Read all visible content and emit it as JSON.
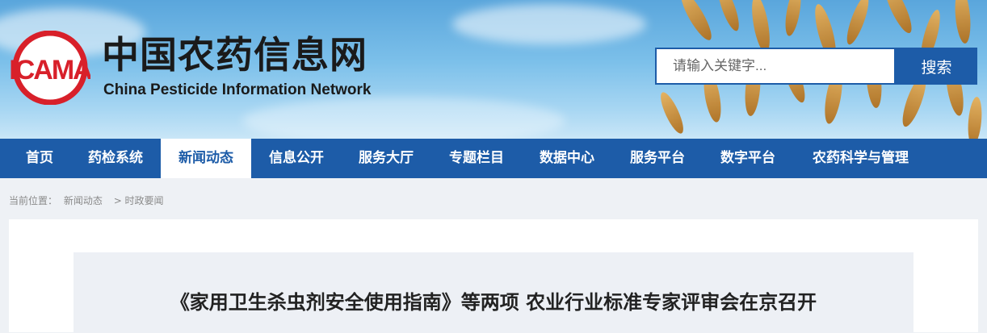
{
  "site": {
    "logo_text": "ICAMA",
    "title": "中国农药信息网",
    "subtitle": "China Pesticide Information Network"
  },
  "search": {
    "placeholder": "请输入关键字...",
    "button_label": "搜索"
  },
  "nav": {
    "items": [
      {
        "label": "首页"
      },
      {
        "label": "药检系统"
      },
      {
        "label": "新闻动态",
        "active": true
      },
      {
        "label": "信息公开"
      },
      {
        "label": "服务大厅"
      },
      {
        "label": "专题栏目"
      },
      {
        "label": "数据中心"
      },
      {
        "label": "服务平台"
      },
      {
        "label": "数字平台"
      },
      {
        "label": "农药科学与管理"
      }
    ]
  },
  "breadcrumb": {
    "prefix": "当前位置：",
    "items": [
      "新闻动态",
      "> 时政要闻"
    ]
  },
  "article": {
    "title": "《家用卫生杀虫剂安全使用指南》等两项 农业行业标准专家评审会在京召开"
  },
  "colors": {
    "brand_blue": "#1d5ca8",
    "logo_red": "#d8202a"
  }
}
